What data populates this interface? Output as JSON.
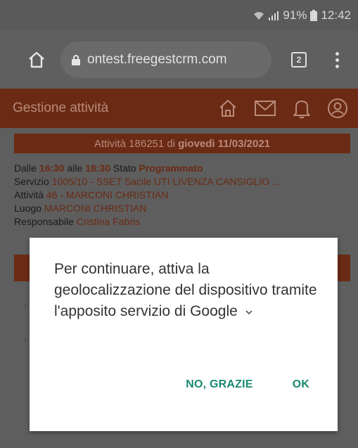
{
  "status_bar": {
    "battery": "91%",
    "time": "12:42"
  },
  "browser": {
    "url": "ontest.freegestcrm.com",
    "tab_count": "2"
  },
  "app": {
    "title": "Gestione attività",
    "icons": [
      "home-icon",
      "mail-icon",
      "bell-icon",
      "account-icon"
    ],
    "accent_color": "#c4532c"
  },
  "activity": {
    "banner_prefix": "Attività 186251 di",
    "banner_date": "giovedì 11/03/2021",
    "from_label": "Dalle",
    "from_time": "16:30",
    "to_label": "alle",
    "to_time": "18:30",
    "state_label": "Stato",
    "state_value": "Programmato",
    "service_label": "Servizio",
    "service_value": "1005/10 - SSET Sacile UTI LIVENZA CANSIGLIO ...",
    "activity_label": "Attività",
    "activity_value": "46 - MARCONI CHRISTIAN",
    "place_label": "Luogo",
    "place_value": "MARCONI CHRISTIAN",
    "manager_label": "Responsabile",
    "manager_value": "Cristina Fabris"
  },
  "dialog": {
    "message": "Per continuare, attiva la geolocalizzazione del dispositivo tramite l'apposito servizio di Google",
    "no_label": "NO, GRAZIE",
    "ok_label": "OK"
  }
}
